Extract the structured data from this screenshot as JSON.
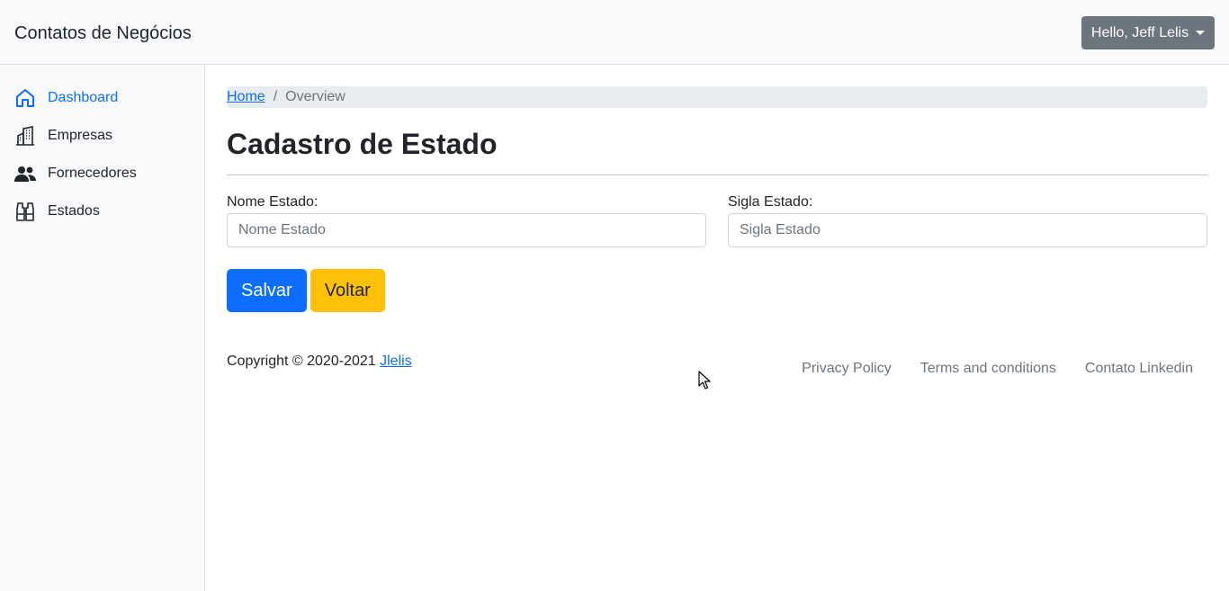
{
  "navbar": {
    "brand": "Contatos de Negócios",
    "user_menu_label": "Hello, Jeff Lelis"
  },
  "sidebar": {
    "items": [
      {
        "label": "Dashboard",
        "icon": "house-icon",
        "active": true
      },
      {
        "label": "Empresas",
        "icon": "buildings-icon",
        "active": false
      },
      {
        "label": "Fornecedores",
        "icon": "people-icon",
        "active": false
      },
      {
        "label": "Estados",
        "icon": "binoculars-icon",
        "active": false
      }
    ]
  },
  "breadcrumb": {
    "home": "Home",
    "separator": "/",
    "current": "Overview"
  },
  "page": {
    "title": "Cadastro de Estado"
  },
  "form": {
    "nome": {
      "label": "Nome Estado:",
      "placeholder": "Nome Estado",
      "value": ""
    },
    "sigla": {
      "label": "Sigla Estado:",
      "placeholder": "Sigla Estado",
      "value": ""
    },
    "save_label": "Salvar",
    "back_label": "Voltar"
  },
  "footer": {
    "copyright": "Copyright © 2020-2021 ",
    "author_link": "Jlelis",
    "links": [
      "Privacy Policy",
      "Terms and conditions",
      "Contato Linkedin"
    ]
  },
  "colors": {
    "primary": "#0d6efd",
    "warning": "#ffc107",
    "secondary": "#6c757d",
    "light": "#f8f9fa"
  }
}
